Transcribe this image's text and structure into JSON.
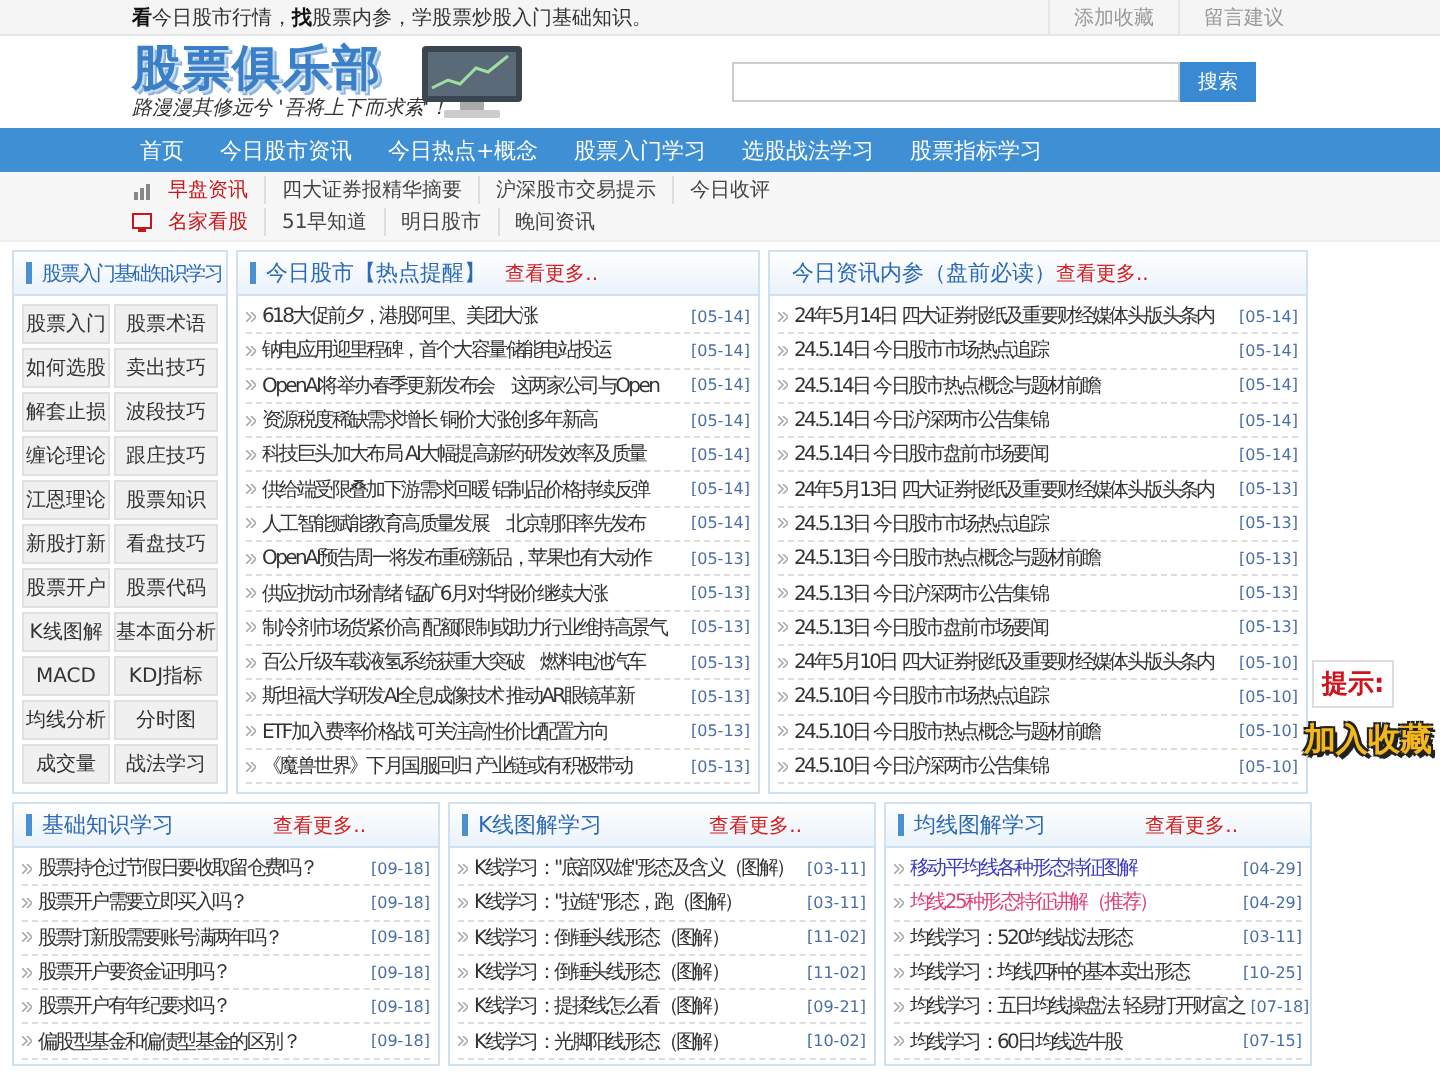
{
  "top_bar": {
    "slogan": "**看**今日股市行情，**找**股票内参，学股票炒股入门基础知识。",
    "links": [
      "添加收藏",
      "留言建议"
    ]
  },
  "header": {
    "logo": "股票俱乐部",
    "tagline": "路漫漫其修远兮 '吾将上下而求索'！",
    "search": {
      "button": "搜索"
    }
  },
  "nav": [
    "首页",
    "今日股市资讯",
    "今日热点+概念",
    "股票入门学习",
    "选股战法学习",
    "股票指标学习"
  ],
  "subnav": [
    {
      "label": "早盘资讯",
      "kind": "chart",
      "links": [
        "四大证券报精华摘要",
        "沪深股市交易提示",
        "今日收评"
      ]
    },
    {
      "label": "名家看股",
      "kind": "screen",
      "links": [
        "51早知道",
        "明日股市",
        "晚间资讯"
      ]
    }
  ],
  "knowledge": {
    "title": "股票入门基础知识学习",
    "buttons": [
      "股票入门",
      "股票术语",
      "如何选股",
      "卖出技巧",
      "解套止损",
      "波段技巧",
      "缠论理论",
      "跟庄技巧",
      "江恩理论",
      "股票知识",
      "新股打新",
      "看盘技巧",
      "股票开户",
      "股票代码",
      "K线图解",
      "基本面分析",
      "MACD",
      "KDJ指标",
      "均线分析",
      "分时图",
      "成交量",
      "战法学习"
    ]
  },
  "news": [
    {
      "title": "今日股市【热点提醒】",
      "more": "查看更多..",
      "items": [
        {
          "text": "618大促前夕，港股阿里、美团大涨",
          "date": "[05-14]"
        },
        {
          "text": "钠电应用迎里程碑，首个大容量储能电站投运",
          "date": "[05-14]"
        },
        {
          "text": "OpenAI将举办春季更新发布会　这两家公司与Open",
          "date": "[05-14]"
        },
        {
          "text": "资源税度稀缺需求增长 铜价大涨创多年新高",
          "date": "[05-14]"
        },
        {
          "text": "科技巨头加大布局 AI大幅提高新药研发效率及质量",
          "date": "[05-14]"
        },
        {
          "text": "供给端受限叠加下游需求回暖 铝制品价格持续反弹",
          "date": "[05-14]"
        },
        {
          "text": "人工智能赋能教育高质量发展　北京朝阳率先发布",
          "date": "[05-14]"
        },
        {
          "text": "OpenAI预告周一将发布重磅新品，苹果也有大动作",
          "date": "[05-13]"
        },
        {
          "text": "供应扰动市场情绪 锰矿6月对华报价继续大涨",
          "date": "[05-13]"
        },
        {
          "text": "制冷剂市场货紧价高 配额限制或助力行业维持高景气",
          "date": "[05-13]"
        },
        {
          "text": "百公斤级车载液氢系统获重大突破　燃料电池汽车",
          "date": "[05-13]"
        },
        {
          "text": "斯坦福大学研发AI全息成像技术 推动AR眼镜革新",
          "date": "[05-13]"
        },
        {
          "text": "ETF加入费率价格战 可关注高性价比配置方向",
          "date": "[05-13]"
        },
        {
          "text": "《魔兽世界》下月国服回归 产业链或有积极带动",
          "date": "[05-13]"
        }
      ]
    },
    {
      "title": "今日资讯内参（盘前必读）",
      "more": "查看更多..",
      "items": [
        {
          "text": "24年5月14日 四大证券报纸及重要财经媒体头版头条内",
          "date": "[05-14]"
        },
        {
          "text": "24.5.14日 今日股市市场热点追踪",
          "date": "[05-14]"
        },
        {
          "text": "24.5.14日 今日股市热点概念与题材前瞻",
          "date": "[05-14]"
        },
        {
          "text": "24.5.14日 今日沪深两市公告集锦",
          "date": "[05-14]"
        },
        {
          "text": "24.5.14日 今日股市盘前市场要闻",
          "date": "[05-14]"
        },
        {
          "text": "24年5月13日 四大证券报纸及重要财经媒体头版头条内",
          "date": "[05-13]"
        },
        {
          "text": "24.5.13日 今日股市市场热点追踪",
          "date": "[05-13]"
        },
        {
          "text": "24.5.13日 今日股市热点概念与题材前瞻",
          "date": "[05-13]"
        },
        {
          "text": "24.5.13日 今日沪深两市公告集锦",
          "date": "[05-13]"
        },
        {
          "text": "24.5.13日 今日股市盘前市场要闻",
          "date": "[05-13]"
        },
        {
          "text": "24年5月10日 四大证券报纸及重要财经媒体头版头条内",
          "date": "[05-10]"
        },
        {
          "text": "24.5.10日 今日股市市场热点追踪",
          "date": "[05-10]"
        },
        {
          "text": "24.5.10日 今日股市热点概念与题材前瞻",
          "date": "[05-10]"
        },
        {
          "text": "24.5.10日 今日沪深两市公告集锦",
          "date": "[05-10]"
        }
      ]
    }
  ],
  "study": [
    {
      "title": "基础知识学习",
      "more": "查看更多..",
      "items": [
        {
          "text": "股票持仓过节假日要收取留仓费吗？",
          "date": "[09-18]",
          "color": "#333333"
        },
        {
          "text": "股票开户需要立即买入吗？",
          "date": "[09-18]",
          "color": "#333333"
        },
        {
          "text": "股票打新股需要账号满两年吗？",
          "date": "[09-18]",
          "color": "#333333"
        },
        {
          "text": "股票开户要资金证明吗？",
          "date": "[09-18]",
          "color": "#333333"
        },
        {
          "text": "股票开户有年纪要求吗？",
          "date": "[09-18]",
          "color": "#333333"
        },
        {
          "text": "偏股型基金和偏债型基金的区别？",
          "date": "[09-18]",
          "color": "#333333"
        }
      ]
    },
    {
      "title": "K线图解学习",
      "more": "查看更多..",
      "items": [
        {
          "text": "K线学习：\"底部双雄\"形态及含义（图解）",
          "date": "[03-11]",
          "color": "#333333"
        },
        {
          "text": "K线学习：\"拉链\"形态，跑（图解）",
          "date": "[03-11]",
          "color": "#333333"
        },
        {
          "text": "K线学习：倒锤头线形态（图解）",
          "date": "[11-02]",
          "color": "#333333"
        },
        {
          "text": "K线学习：倒锤头线形态（图解）",
          "date": "[11-02]",
          "color": "#333333"
        },
        {
          "text": "K线学习：提揉线怎么看（图解）",
          "date": "[09-21]",
          "color": "#333333"
        },
        {
          "text": "K线学习：光脚阳线形态（图解）",
          "date": "[10-02]",
          "color": "#333333"
        }
      ]
    },
    {
      "title": "均线图解学习",
      "more": "查看更多..",
      "items": [
        {
          "text": "移动平均线各种形态特征图解",
          "date": "[04-29]",
          "color": "#3b3bc4"
        },
        {
          "text": "均线25种形态特征讲解（推荐）",
          "date": "[04-29]",
          "color": "#e0407a"
        },
        {
          "text": "均线学习：520均线战法形态",
          "date": "[03-11]",
          "color": "#333333"
        },
        {
          "text": "均线学习：均线四种的基本卖出形态",
          "date": "[10-25]",
          "color": "#333333"
        },
        {
          "text": "均线学习：五日均线操盘法 轻易打开财富之",
          "date": "[07-18]",
          "color": "#333333"
        },
        {
          "text": "均线学习：60日均线选牛股",
          "date": "[07-15]",
          "color": "#333333"
        }
      ]
    }
  ],
  "float_ads": {
    "tip": "提示:",
    "bookmark": "加入收藏"
  }
}
